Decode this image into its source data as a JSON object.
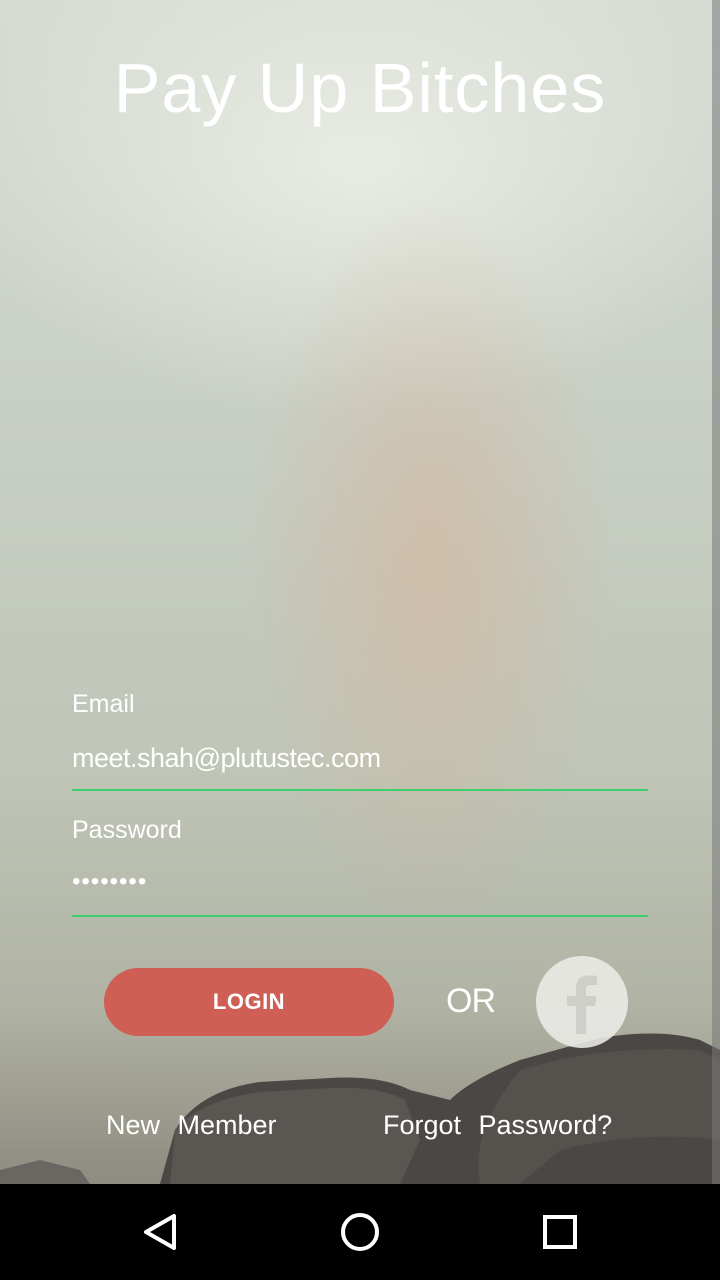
{
  "app": {
    "title": "Pay Up Bitches"
  },
  "form": {
    "email_label": "Email",
    "email_value": "meet.shah@plutustec.com",
    "password_label": "Password",
    "password_value": "••••••••"
  },
  "actions": {
    "login_label": "LOGIN",
    "or_label": "OR",
    "facebook_icon": "facebook-icon"
  },
  "links": {
    "new_member": "New Member",
    "forgot_password": "Forgot Password?"
  },
  "navbar": {
    "back_icon": "back-icon",
    "home_icon": "home-icon",
    "recents_icon": "recents-icon"
  },
  "colors": {
    "accent_line": "#3fcf6a",
    "login_button": "#cf5f55",
    "text": "#ffffff"
  }
}
